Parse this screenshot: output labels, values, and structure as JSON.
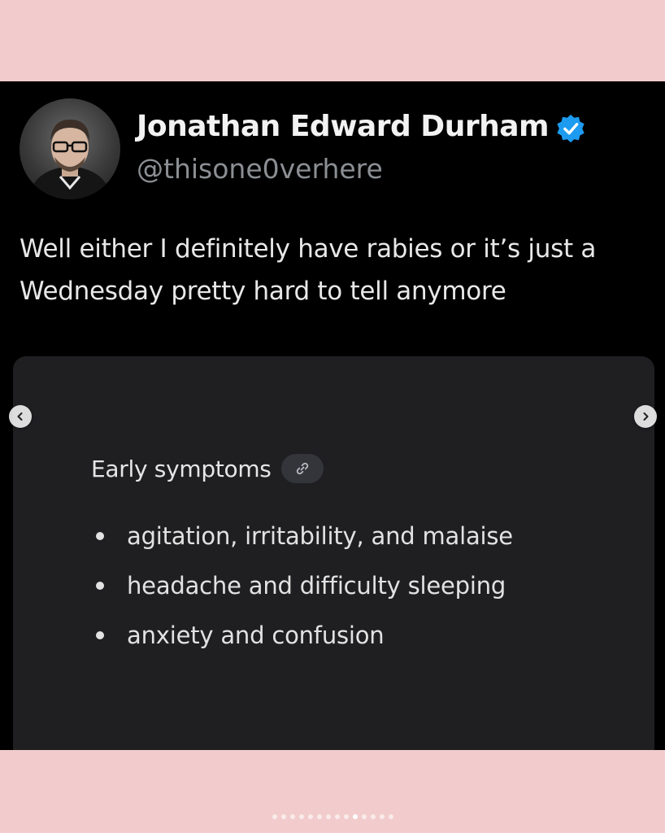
{
  "post": {
    "author": {
      "name": "Jonathan Edward Durham",
      "handle": "@thisone0verhere",
      "verified": true,
      "avatar_icon": "person-glasses-avatar"
    },
    "text_lines": [
      "Well either I definitely have rabies or it’s just a",
      "Wednesday pretty hard to tell anymore"
    ],
    "card": {
      "heading": "Early symptoms",
      "heading_icon": "link-icon",
      "items": [
        "agitation, irritability, and malaise",
        "headache and difficulty sleeping",
        "anxiety and confusion"
      ]
    }
  },
  "carousel": {
    "prev_icon": "chevron-left-icon",
    "next_icon": "chevron-right-icon",
    "total_slides": 14,
    "active_slide": 10
  },
  "colors": {
    "page_background": "#f2cccc",
    "post_background": "#000000",
    "card_background": "#1f1f22",
    "verified_blue": "#1d9bf0",
    "handle_gray": "#8b8f94"
  }
}
